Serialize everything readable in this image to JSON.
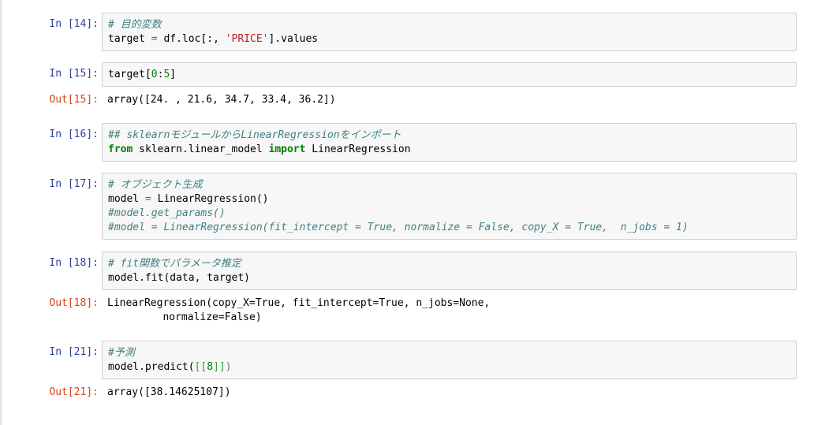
{
  "cells": [
    {
      "prompt": "In [14]:",
      "lines": [
        [
          {
            "t": "# 目的変数",
            "c": "cm-comment"
          }
        ],
        [
          {
            "t": "target ",
            "c": ""
          },
          {
            "t": "=",
            "c": "cm-operator"
          },
          {
            "t": " df.loc[:, ",
            "c": ""
          },
          {
            "t": "'PRICE'",
            "c": "cm-string"
          },
          {
            "t": "].values",
            "c": ""
          }
        ]
      ]
    },
    {
      "prompt": "In [15]:",
      "lines": [
        [
          {
            "t": "target[",
            "c": ""
          },
          {
            "t": "0",
            "c": "cm-number"
          },
          {
            "t": ":",
            "c": ""
          },
          {
            "t": "5",
            "c": "cm-number"
          },
          {
            "t": "]",
            "c": ""
          }
        ]
      ]
    },
    {
      "prompt": "Out[15]:",
      "lines": [
        "array([24. , 21.6, 34.7, 33.4, 36.2])"
      ]
    },
    {
      "prompt": "In [16]:",
      "lines": [
        [
          {
            "t": "## sklearnモジュールからLinearRegressionをインポート",
            "c": "cm-comment"
          }
        ],
        [
          {
            "t": "from",
            "c": "cm-keyword"
          },
          {
            "t": " sklearn.linear_model ",
            "c": ""
          },
          {
            "t": "import",
            "c": "cm-keyword"
          },
          {
            "t": " LinearRegression",
            "c": ""
          }
        ]
      ]
    },
    {
      "prompt": "In [17]:",
      "lines": [
        [
          {
            "t": "# オブジェクト生成",
            "c": "cm-comment"
          }
        ],
        [
          {
            "t": "model ",
            "c": ""
          },
          {
            "t": "=",
            "c": "cm-operator"
          },
          {
            "t": " LinearRegression()",
            "c": ""
          }
        ],
        [
          {
            "t": "#model.get_params()",
            "c": "cm-comment"
          }
        ],
        [
          {
            "t": "#model = LinearRegression(fit_intercept = True, normalize = False, copy_X = True,  n_jobs = 1)",
            "c": "cm-comment"
          }
        ]
      ]
    },
    {
      "prompt": "In [18]:",
      "lines": [
        [
          {
            "t": "# fit関数でパラメータ推定",
            "c": "cm-comment"
          }
        ],
        [
          {
            "t": "model.fit(data, target)",
            "c": ""
          }
        ]
      ]
    },
    {
      "prompt": "Out[18]:",
      "lines": [
        "LinearRegression(copy_X=True, fit_intercept=True, n_jobs=None,",
        "         normalize=False)"
      ]
    },
    {
      "prompt": "In [21]:",
      "lines": [
        [
          {
            "t": "#予測",
            "c": "cm-comment"
          }
        ],
        [
          {
            "t": "model.predict(",
            "c": ""
          },
          {
            "t": "[[",
            "c": "cm-bracket"
          },
          {
            "t": "8",
            "c": "cm-number"
          },
          {
            "t": "]]",
            "c": "cm-bracket"
          },
          {
            "t": ")",
            "c": "cm-bracket"
          }
        ]
      ]
    },
    {
      "prompt": "Out[21]:",
      "lines": [
        "array([38.14625107])"
      ]
    }
  ]
}
